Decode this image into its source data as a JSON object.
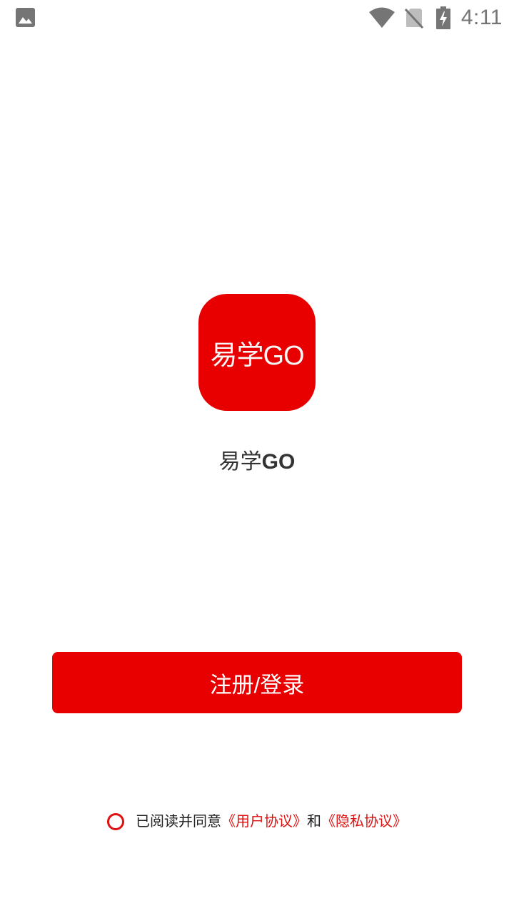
{
  "status_bar": {
    "time": "4:11",
    "icons": [
      "image-icon",
      "wifi-icon",
      "no-sim-icon",
      "battery-charging-icon"
    ]
  },
  "app": {
    "logo_text": "易学GO",
    "name_prefix": "易学",
    "name_suffix": "GO"
  },
  "login_button": {
    "label": "注册/登录"
  },
  "agreement": {
    "prefix": "已阅读并同意",
    "user_agreement": "《用户协议》",
    "conjunction": "和",
    "privacy_policy": "《隐私协议》",
    "checked": false
  },
  "colors": {
    "brand_red": "#e80000",
    "link_red": "#e01010",
    "status_gray": "#757575"
  }
}
